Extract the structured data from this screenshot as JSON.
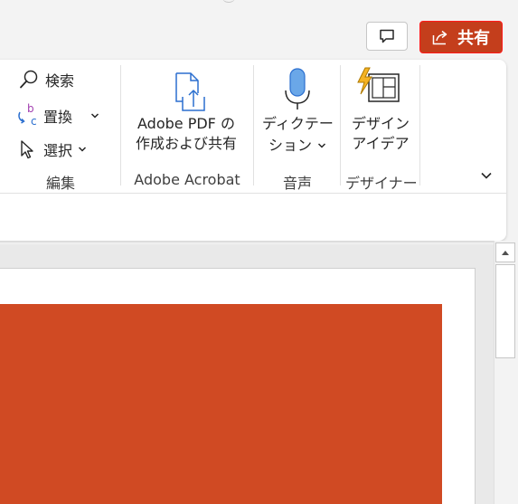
{
  "titlebar": {
    "share_label": "共有",
    "share_icon": "share-icon",
    "comment_icon": "comment-icon",
    "colors": {
      "share_bg": "#c43e1c",
      "share_border": "#ff1a1a"
    }
  },
  "ribbon": {
    "editing_group": {
      "find_label": "検索",
      "replace_label": "置換",
      "select_label": "選択",
      "group_label": "編集"
    },
    "acrobat_group": {
      "button_line1": "Adobe PDF の",
      "button_line2": "作成および共有",
      "group_label": "Adobe Acrobat"
    },
    "voice_group": {
      "button_line1": "ディクテー",
      "button_line2": "ション",
      "group_label": "音声"
    },
    "designer_group": {
      "button_line1": "デザイン",
      "button_line2": "アイデア",
      "group_label": "デザイナー"
    }
  },
  "slide": {
    "shape_color": "#d04a23"
  }
}
